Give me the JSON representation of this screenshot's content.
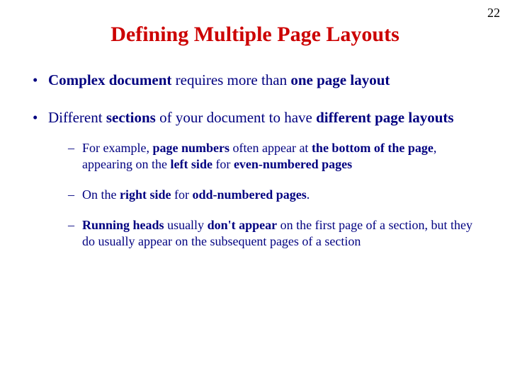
{
  "page_number": "22",
  "title": "Defining Multiple Page Layouts",
  "bullets": {
    "b1": {
      "t1": "Complex document",
      "t2": " requires more than ",
      "t3": "one page layout"
    },
    "b2": {
      "t1": "Different ",
      "t2": "sections",
      "t3": " of your document to have ",
      "t4": "different page layouts",
      "sub": {
        "s1": {
          "t1": "For example, ",
          "t2": "page numbers",
          "t3": " often appear at ",
          "t4": "the bottom of the page",
          "t5": ", appearing on the ",
          "t6": "left side",
          "t7": " for ",
          "t8": "even-numbered pages"
        },
        "s2": {
          "t1": "On the ",
          "t2": "right side",
          "t3": " for ",
          "t4": "odd-numbered pages",
          "t5": "."
        },
        "s3": {
          "t1": "Running heads",
          "t2": " usually ",
          "t3": "don't appear",
          "t4": " on the first page of a section, but they do usually appear on the subsequent pages of a section"
        }
      }
    }
  }
}
